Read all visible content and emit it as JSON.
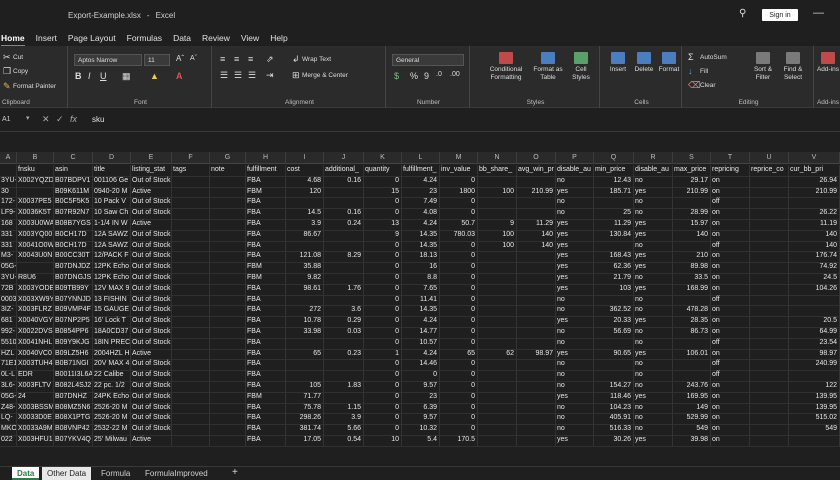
{
  "window": {
    "file_name": "Export-Example.xlsx",
    "separator": "-",
    "app_name": "Excel",
    "sign_in_label": "Sign in",
    "minimize_glyph": "—"
  },
  "menu": [
    "Home",
    "Insert",
    "Page Layout",
    "Formulas",
    "Data",
    "Review",
    "View",
    "Help"
  ],
  "ribbon": {
    "clipboard": {
      "cut": "Cut",
      "copy": "Copy",
      "format_painter": "Format Painter",
      "label": "Clipboard"
    },
    "font": {
      "name": "Aptos Narrow",
      "size": "11",
      "label": "Font"
    },
    "alignment": {
      "wrap_text": "Wrap Text",
      "merge_center": "Merge & Center",
      "label": "Alignment"
    },
    "number": {
      "format": "General",
      "label": "Number"
    },
    "styles": {
      "conditional": "Conditional Formatting",
      "format_table": "Format as Table",
      "cell_styles": "Cell Styles",
      "label": "Styles"
    },
    "cells": {
      "insert": "Insert",
      "delete": "Delete",
      "format": "Format",
      "label": "Cells"
    },
    "editing": {
      "autosum": "AutoSum",
      "fill": "Fill",
      "clear": "Clear",
      "sort": "Sort & Filter",
      "find": "Find & Select",
      "label": "Editing"
    },
    "addins": {
      "button": "Add-ins",
      "label": "Add-ins"
    }
  },
  "formula_bar": {
    "name_box": "A1",
    "value": "sku"
  },
  "columns": [
    "A",
    "B",
    "C",
    "D",
    "E",
    "F",
    "G",
    "H",
    "I",
    "J",
    "K",
    "L",
    "M",
    "N",
    "O",
    "P",
    "Q",
    "R",
    "S",
    "T",
    "U",
    "V"
  ],
  "header_row": [
    "",
    "fnsku",
    "asin",
    "title",
    "listing_stat",
    "tags",
    "note",
    "fulfillment",
    "cost",
    "additional_",
    "quantity",
    "fulfillment_",
    "inv_value",
    "bb_share_",
    "avg_win_pr",
    "disable_au",
    "min_price",
    "disable_au",
    "max_price",
    "repricing",
    "reprice_co",
    "cur_bb_pri"
  ],
  "rows": [
    [
      "3YU-",
      "X002YQZD",
      "B07BDPV1",
      "001106 Ge",
      "Out of Stock",
      "",
      "",
      "FBA",
      "4.68",
      "0.16",
      "0",
      "4.24",
      "0",
      "",
      "",
      "no",
      "12.43",
      "no",
      "29.17",
      "on",
      "",
      "26.94"
    ],
    [
      "30",
      "",
      "B09K611M",
      "0940-20 M",
      "Active",
      "",
      "",
      "FBM",
      "120",
      "",
      "15",
      "23",
      "1800",
      "100",
      "210.99",
      "yes",
      "185.71",
      "yes",
      "210.99",
      "on",
      "",
      "210.99"
    ],
    [
      "172-",
      "X0037PE5",
      "B0C5F5K5",
      "10 Pack V",
      "Out of Stock",
      "",
      "",
      "FBA",
      "",
      "",
      "0",
      "7.49",
      "0",
      "",
      "",
      "no",
      "",
      "no",
      "",
      "off",
      "",
      ""
    ],
    [
      "LF9-",
      "X0036K5T",
      "B07R92N7",
      "10 Saw Ch",
      "Out of Stock",
      "",
      "",
      "FBA",
      "14.5",
      "0.16",
      "0",
      "4.08",
      "0",
      "",
      "",
      "no",
      "25",
      "no",
      "28.99",
      "on",
      "",
      "26.22"
    ],
    [
      "168",
      "X003U0WA",
      "B08B7YGS",
      "1-1/4 IN W",
      "Active",
      "",
      "",
      "FBA",
      "3.9",
      "0.24",
      "13",
      "4.24",
      "50.7",
      "9",
      "11.29",
      "yes",
      "11.29",
      "yes",
      "15.97",
      "on",
      "",
      "11.19"
    ],
    [
      "331",
      "X003YQ00",
      "B0CH17D",
      "12A SAWZ",
      "Out of Stock",
      "",
      "",
      "FBA",
      "86.67",
      "",
      "9",
      "14.35",
      "780.03",
      "100",
      "140",
      "yes",
      "130.84",
      "yes",
      "140",
      "on",
      "",
      "140"
    ],
    [
      "331",
      "X0041O0W",
      "B0CH17D",
      "12A SAWZ",
      "Out of Stock",
      "",
      "",
      "FBA",
      "",
      "",
      "0",
      "14.35",
      "0",
      "100",
      "140",
      "yes",
      "",
      "no",
      "",
      "off",
      "",
      "140"
    ],
    [
      "M3-",
      "X0043U0N",
      "B00CC30T",
      "12/PACK F",
      "Out of Stock",
      "",
      "",
      "FBA",
      "121.08",
      "8.29",
      "0",
      "18.13",
      "0",
      "",
      "",
      "yes",
      "168.43",
      "yes",
      "210",
      "on",
      "",
      "176.74"
    ],
    [
      "05G-",
      "",
      "B07DNJDZ",
      "12PK Echo",
      "Out of Stock",
      "",
      "",
      "FBM",
      "35.88",
      "",
      "0",
      "16",
      "0",
      "",
      "",
      "yes",
      "62.36",
      "yes",
      "89.98",
      "on",
      "",
      "74.92"
    ],
    [
      "3YU-",
      "R8U6",
      "B07DNGJS",
      "12PK Echo",
      "Out of Stock",
      "",
      "",
      "FBM",
      "9.82",
      "",
      "0",
      "8.8",
      "0",
      "",
      "",
      "yes",
      "21.79",
      "no",
      "33.5",
      "on",
      "",
      "24.5"
    ],
    [
      "72B",
      "X003YODE",
      "B09TB99Y",
      "12V MAX 9",
      "Out of Stock",
      "",
      "",
      "FBA",
      "98.61",
      "1.76",
      "0",
      "7.65",
      "0",
      "",
      "",
      "yes",
      "103",
      "yes",
      "168.99",
      "on",
      "",
      "104.26"
    ],
    [
      "0003",
      "X003XW9Y",
      "B07YNNJD",
      "13 FISHIN",
      "Out of Stock",
      "",
      "",
      "FBA",
      "",
      "",
      "0",
      "11.41",
      "0",
      "",
      "",
      "no",
      "",
      "no",
      "",
      "off",
      "",
      ""
    ],
    [
      "3IZ-",
      "X003FLRZ",
      "B09VMP4F",
      "15 GAUGE",
      "Out of Stock",
      "",
      "",
      "FBA",
      "272",
      "3.6",
      "0",
      "14.35",
      "0",
      "",
      "",
      "no",
      "362.52",
      "no",
      "478.28",
      "on",
      "",
      ""
    ],
    [
      "681",
      "X0040VGY",
      "B07NP2P5",
      "16' Lock T",
      "Out of Stock",
      "",
      "",
      "FBA",
      "10.78",
      "0.29",
      "0",
      "4.24",
      "0",
      "",
      "",
      "yes",
      "20.33",
      "yes",
      "28.35",
      "on",
      "",
      "20.5"
    ],
    [
      "992-",
      "X0022DVS",
      "B0854PP6",
      "18A0CD37",
      "Out of Stock",
      "",
      "",
      "FBA",
      "33.98",
      "0.03",
      "0",
      "14.77",
      "0",
      "",
      "",
      "no",
      "56.69",
      "no",
      "86.73",
      "on",
      "",
      "64.99"
    ],
    [
      "5510",
      "X0041NHL",
      "B09Y9KJG",
      "18IN PREC",
      "Out of Stock",
      "",
      "",
      "FBA",
      "",
      "",
      "0",
      "10.57",
      "0",
      "",
      "",
      "no",
      "",
      "no",
      "",
      "off",
      "",
      "23.54"
    ],
    [
      "HZL",
      "X0040VC0",
      "B09LZ5H6",
      "2004HZL H",
      "Active",
      "",
      "",
      "FBA",
      "65",
      "0.23",
      "1",
      "4.24",
      "65",
      "62",
      "98.97",
      "yes",
      "90.65",
      "yes",
      "106.01",
      "on",
      "",
      "98.97"
    ],
    [
      "71E1",
      "X003TUH4",
      "B0B71NGI",
      "20V MAX 4",
      "Out of Stock",
      "",
      "",
      "FBA",
      "",
      "",
      "0",
      "14.46",
      "0",
      "",
      "",
      "no",
      "",
      "no",
      "",
      "off",
      "",
      "240.99"
    ],
    [
      "0L-L",
      "EDR",
      "B0011I3L6A",
      "22 Calibe",
      "Out of Stock",
      "",
      "",
      "FBA",
      "",
      "",
      "0",
      "0",
      "0",
      "",
      "",
      "no",
      "",
      "no",
      "",
      "off",
      "",
      ""
    ],
    [
      "3L6-",
      "X003FLTV",
      "B082L4SJ2",
      "22 pc. 1/2",
      "Out of Stock",
      "",
      "",
      "FBA",
      "105",
      "1.83",
      "0",
      "9.57",
      "0",
      "",
      "",
      "no",
      "154.27",
      "no",
      "243.76",
      "on",
      "",
      "122"
    ],
    [
      "05G-",
      "24",
      "B07DNHZ",
      "24PK Echo",
      "Out of Stock",
      "",
      "",
      "FBM",
      "71.77",
      "",
      "0",
      "23",
      "0",
      "",
      "",
      "yes",
      "118.46",
      "yes",
      "169.95",
      "on",
      "",
      "139.95"
    ],
    [
      "Z48-",
      "X003BSSM",
      "B08MZ5N6",
      "2526-20 M",
      "Out of Stock",
      "",
      "",
      "FBA",
      "75.78",
      "1.15",
      "0",
      "6.39",
      "0",
      "",
      "",
      "no",
      "104.23",
      "no",
      "149",
      "on",
      "",
      "139.95"
    ],
    [
      "LQ-",
      "X0033D0E",
      "B08X1PTG",
      "2526-20 M",
      "Out of Stock",
      "",
      "",
      "FBA",
      "298.26",
      "3.9",
      "0",
      "9.57",
      "0",
      "",
      "",
      "no",
      "405.91",
      "no",
      "529.99",
      "on",
      "",
      "515.02"
    ],
    [
      "MKO",
      "X0033A9M",
      "B08VNP42",
      "2532-22 M",
      "Out of Stock",
      "",
      "",
      "FBA",
      "381.74",
      "5.66",
      "0",
      "10.32",
      "0",
      "",
      "",
      "no",
      "516.33",
      "no",
      "549",
      "on",
      "",
      "549"
    ],
    [
      "022",
      "X003HFU1",
      "B07YKV4Q",
      "25' Milwau",
      "Active",
      "",
      "",
      "FBA",
      "17.05",
      "0.54",
      "10",
      "5.4",
      "170.5",
      "",
      "",
      "yes",
      "30.26",
      "yes",
      "39.98",
      "on",
      "",
      ""
    ]
  ],
  "sheet_tabs": [
    "Data",
    "Other Data",
    "Formula",
    "FormulaImproved"
  ],
  "add_sheet": "+"
}
